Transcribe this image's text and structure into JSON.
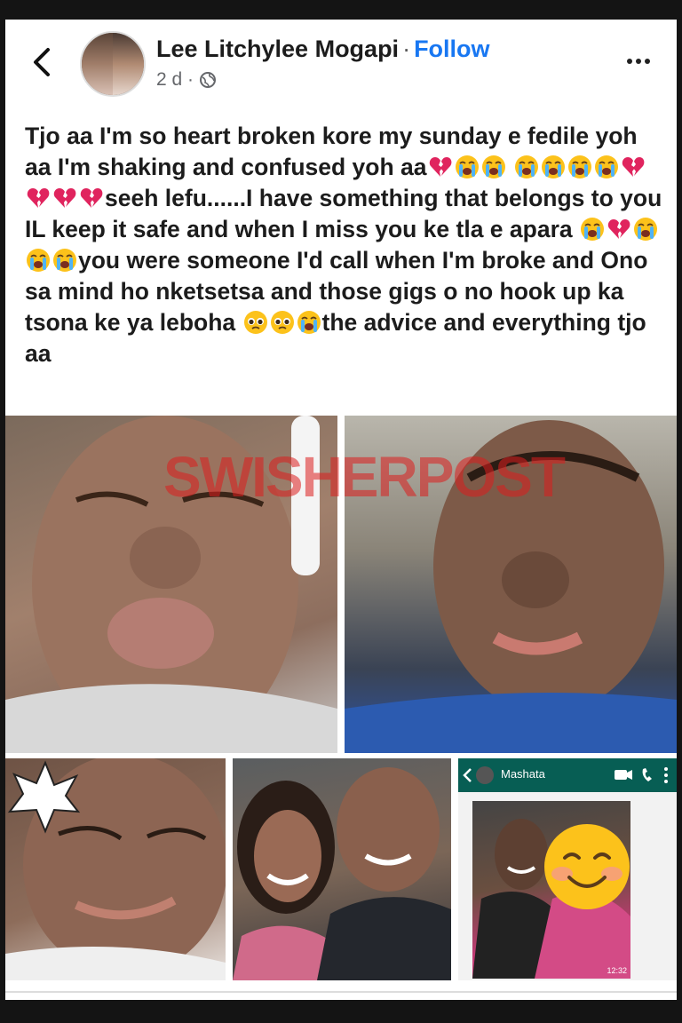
{
  "header": {
    "back_icon": "chevron-left-icon",
    "author_name": "Lee Litchylee Mogapi",
    "separator": "·",
    "follow_label": "Follow",
    "time_ago": "2 d ·",
    "privacy_icon": "globe-icon",
    "more_icon": "more-horizontal-icon"
  },
  "post": {
    "seg1": "Tjo aa I'm so heart broken kore my sunday e fedile yoh aa I'm shaking and confused yoh aa",
    "seg2": "seeh lefu......I have something that belongs to you IL keep it safe and when I miss you ke tla e apara",
    "seg3": "you were someone I'd call when I'm broke and Ono sa mind ho nketsetsa and those gigs o no hook up ka tsona ke ya leboha",
    "seg4": "the advice and everything tjo aa"
  },
  "media": {
    "watermark": "SWISHERPOST",
    "chat_contact": "Mashata",
    "chat_time": "12:32",
    "colors": {
      "chat_header": "#075e54",
      "follow": "#1877f2",
      "watermark": "#dc1e1e"
    }
  }
}
